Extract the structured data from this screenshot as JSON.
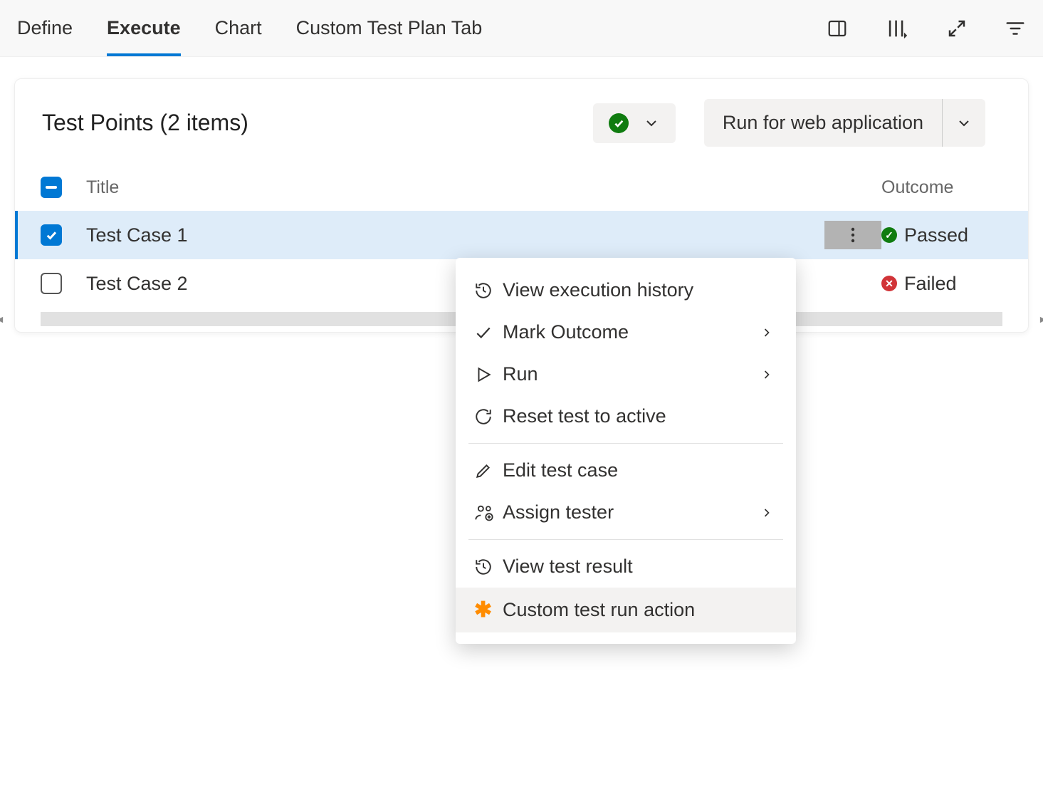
{
  "tabs": {
    "define": "Define",
    "execute": "Execute",
    "chart": "Chart",
    "custom": "Custom Test Plan Tab"
  },
  "panel": {
    "title": "Test Points (2 items)",
    "run_label": "Run for web application"
  },
  "table": {
    "headers": {
      "title": "Title",
      "outcome": "Outcome"
    },
    "rows": [
      {
        "title": "Test Case 1",
        "outcome": "Passed",
        "status": "pass",
        "selected": true
      },
      {
        "title": "Test Case 2",
        "outcome": "Failed",
        "status": "fail",
        "selected": false
      }
    ]
  },
  "menu": {
    "view_history": "View execution history",
    "mark_outcome": "Mark Outcome",
    "run": "Run",
    "reset": "Reset test to active",
    "edit": "Edit test case",
    "assign": "Assign tester",
    "view_result": "View test result",
    "custom_action": "Custom test run action"
  }
}
